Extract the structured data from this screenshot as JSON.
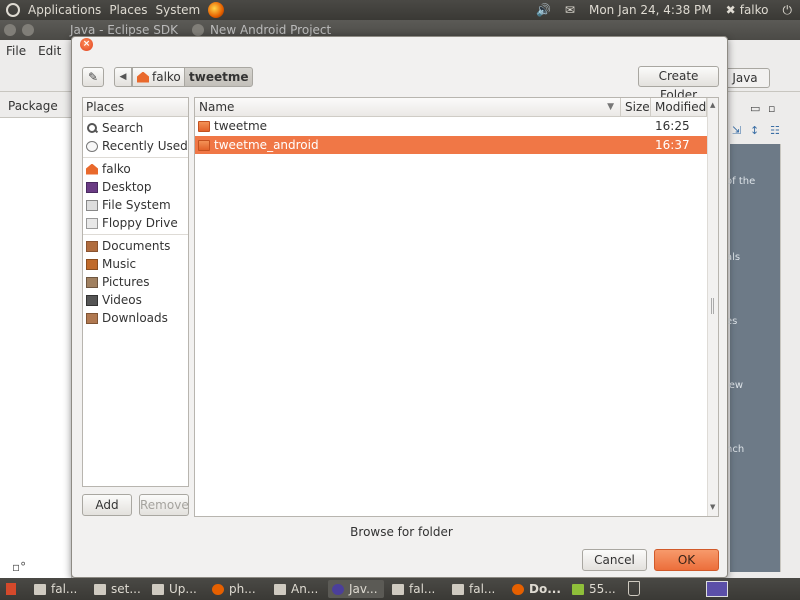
{
  "top_panel": {
    "menus": [
      "Applications",
      "Places",
      "System"
    ],
    "datetime": "Mon Jan 24, 4:38 PM",
    "user": "falko"
  },
  "eclipse": {
    "title": "Java - Eclipse SDK",
    "subtitle": "New Android Project",
    "menu": [
      "File",
      "Edit"
    ],
    "package_tab": "Package",
    "java_label": "Java",
    "help_snippets": [
      "of the",
      "als",
      "es",
      "iew",
      "nch"
    ]
  },
  "dialog": {
    "breadcrumb": [
      "falko",
      "tweetme"
    ],
    "create_folder": "Create Folder",
    "places": {
      "header": "Places",
      "group1": [
        {
          "label": "Search",
          "icon": "search-icon"
        },
        {
          "label": "Recently Used",
          "icon": "recently-used-icon"
        }
      ],
      "group2": [
        {
          "label": "falko",
          "icon": "home-folder-icon"
        },
        {
          "label": "Desktop",
          "icon": "desktop-icon"
        },
        {
          "label": "File System",
          "icon": "file-system-icon"
        },
        {
          "label": "Floppy Drive",
          "icon": "floppy-drive-icon"
        }
      ],
      "group3": [
        {
          "label": "Documents",
          "icon": "documents-folder-icon"
        },
        {
          "label": "Music",
          "icon": "music-folder-icon"
        },
        {
          "label": "Pictures",
          "icon": "pictures-folder-icon"
        },
        {
          "label": "Videos",
          "icon": "videos-folder-icon"
        },
        {
          "label": "Downloads",
          "icon": "downloads-folder-icon"
        }
      ]
    },
    "add_button": "Add",
    "remove_button": "Remove",
    "columns": {
      "name": "Name",
      "size": "Size",
      "modified": "Modified"
    },
    "files": [
      {
        "name": "tweetme",
        "size": "",
        "modified": "16:25",
        "selected": false
      },
      {
        "name": "tweetme_android",
        "size": "",
        "modified": "16:37",
        "selected": true
      }
    ],
    "status": "Browse for folder",
    "cancel_button": "Cancel",
    "ok_button": "OK"
  },
  "taskbar": {
    "tasks": [
      "fal...",
      "set...",
      "Up...",
      "ph...",
      "An...",
      "Jav...",
      "fal...",
      "fal...",
      "Do...",
      "55..."
    ]
  },
  "colors": {
    "selection": "#f07746",
    "ok_button": "#ec6e3b",
    "panel": "#3c3b37"
  }
}
